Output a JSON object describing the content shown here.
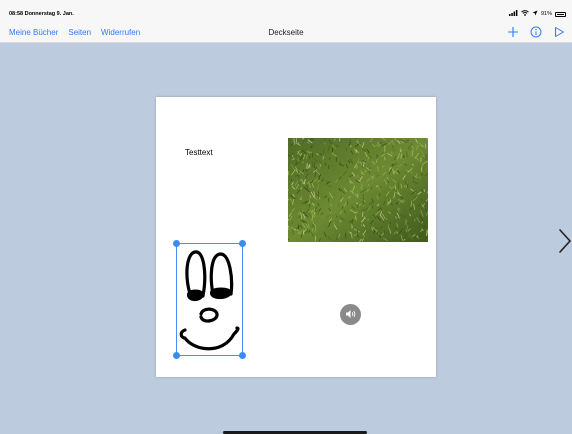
{
  "status_bar": {
    "time_date": "08:58  Donnerstag 9. Jan.",
    "battery": "91%"
  },
  "nav": {
    "left_links": [
      "Meine Bücher",
      "Seiten",
      "Widerrufen"
    ],
    "title": "Deckseite",
    "actions": [
      "plus-icon",
      "info-icon",
      "play-icon"
    ]
  },
  "page": {
    "text": "Testtext",
    "image": "grass-photo",
    "drawing": "smiley-drawing",
    "audio": "speaker-icon"
  },
  "colors": {
    "accent": "#2f7bf5",
    "background": "#bccbdd",
    "selection": "#3a8cf5"
  }
}
